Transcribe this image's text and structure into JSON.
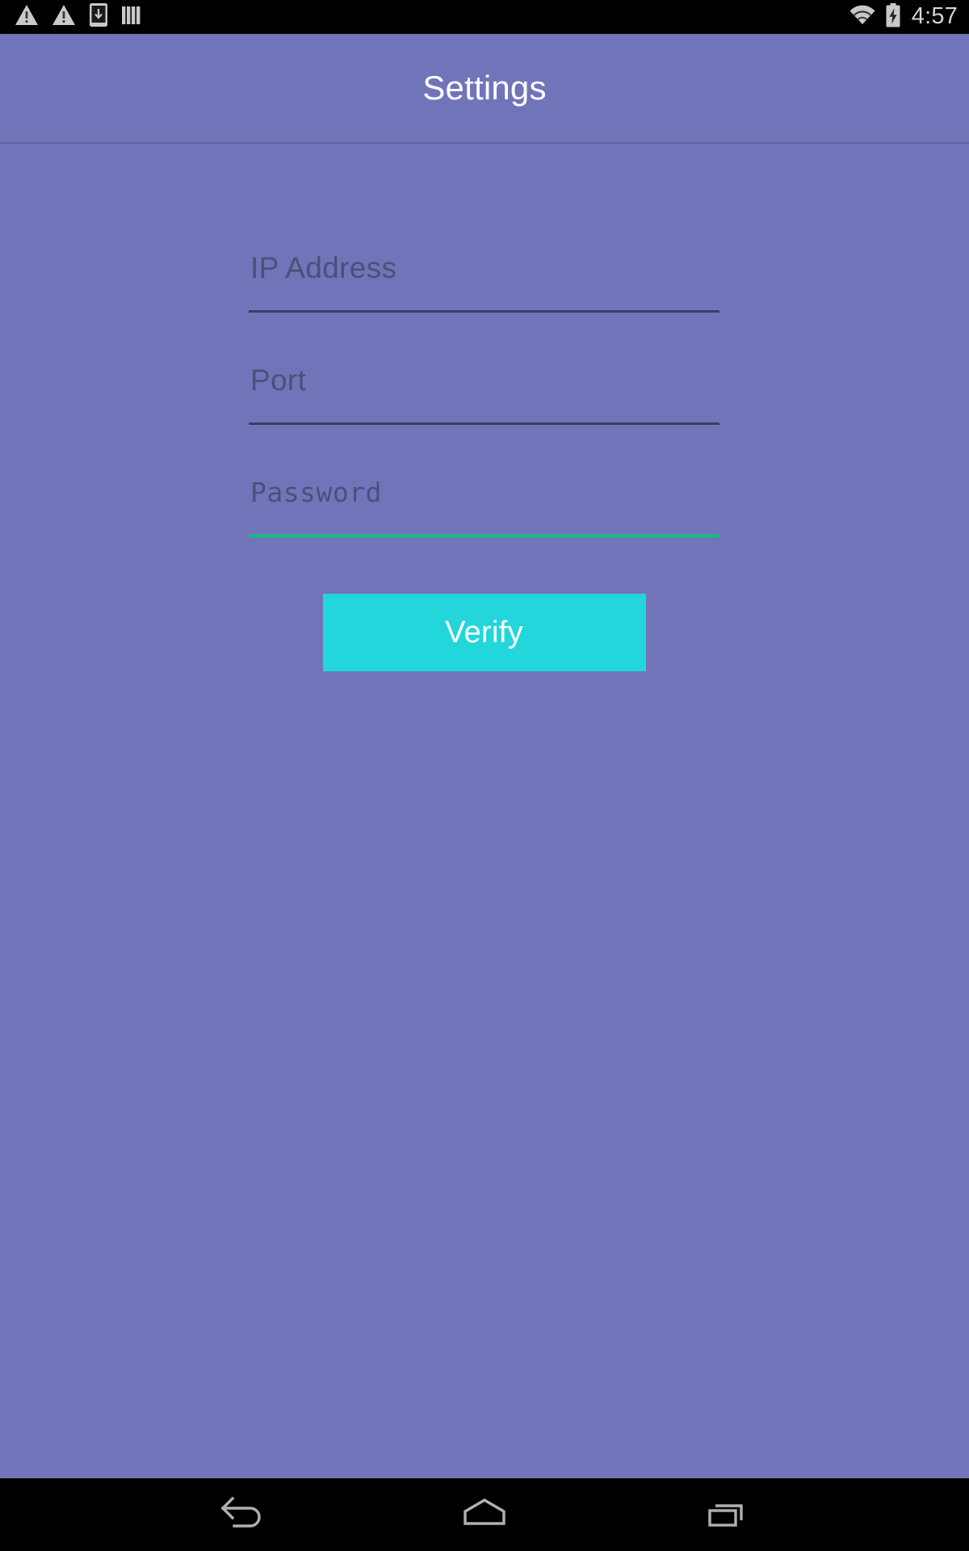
{
  "status_bar": {
    "left_icons": [
      {
        "name": "warning-triangle-icon-1",
        "glyph": "warning"
      },
      {
        "name": "warning-triangle-icon-2",
        "glyph": "warning"
      },
      {
        "name": "download-to-device-icon",
        "glyph": "device-download"
      },
      {
        "name": "signal-bars-icon",
        "glyph": "bars"
      }
    ],
    "right_icons": [
      {
        "name": "wifi-icon",
        "glyph": "wifi"
      },
      {
        "name": "battery-charging-icon",
        "glyph": "battery-charging"
      }
    ],
    "clock": "4:57"
  },
  "toolbar": {
    "title": "Settings"
  },
  "form": {
    "fields": [
      {
        "name": "ip-address-field",
        "placeholder": "IP Address",
        "value": "",
        "focused": false,
        "monospace": false
      },
      {
        "name": "port-field",
        "placeholder": "Port",
        "value": "",
        "focused": false,
        "monospace": false
      },
      {
        "name": "password-field",
        "placeholder": "Password",
        "value": "",
        "focused": true,
        "monospace": true
      }
    ],
    "ip_placeholder": "IP Address",
    "port_placeholder": "Port",
    "password_placeholder": "Password"
  },
  "actions": {
    "verify_label": "Verify"
  },
  "nav_bar": {
    "buttons": [
      {
        "name": "nav-back-button",
        "glyph": "back-arrow"
      },
      {
        "name": "nav-home-button",
        "glyph": "home"
      },
      {
        "name": "nav-recents-button",
        "glyph": "recents"
      }
    ]
  },
  "colors": {
    "background": "#7274b9",
    "toolbar": "#7274b9",
    "status_bar": "#000000",
    "nav_bar": "#000000",
    "hint_text": "#4e4f7a",
    "underline": "#3c3e63",
    "underline_focused": "#1fb28d",
    "accent_button": "#22d6dc",
    "button_text": "#ffffff",
    "title_text": "#ffffff",
    "status_icon": "#c9c9c9"
  }
}
